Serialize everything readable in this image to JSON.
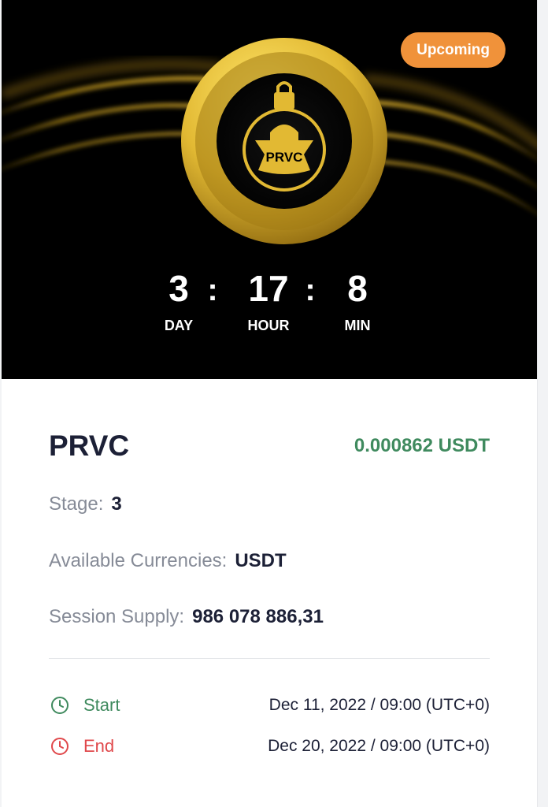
{
  "hero": {
    "badge": "Upcoming",
    "logo_text": "PRVC",
    "countdown": [
      {
        "value": "3",
        "label": "DAY"
      },
      {
        "value": "17",
        "label": "HOUR"
      },
      {
        "value": "8",
        "label": "MIN"
      }
    ],
    "separator": ":"
  },
  "token": {
    "name": "PRVC",
    "price": "0.000862 USDT"
  },
  "details": [
    {
      "key": "Stage:",
      "value": "3"
    },
    {
      "key": "Available Currencies:",
      "value": "USDT"
    },
    {
      "key": "Session Supply:",
      "value": "986 078 886,31"
    }
  ],
  "schedule": {
    "start": {
      "label": "Start",
      "value": "Dec 11, 2022 / 09:00 (UTC+0)",
      "icon": "clock-icon",
      "color": "#3f8a5e"
    },
    "end": {
      "label": "End",
      "value": "Dec 20, 2022 / 09:00 (UTC+0)",
      "icon": "clock-icon",
      "color": "#e0484b"
    }
  },
  "colors": {
    "badge": "#f0923a",
    "gold": "#e2b933",
    "price": "#3f8a5e",
    "end": "#e0484b"
  }
}
